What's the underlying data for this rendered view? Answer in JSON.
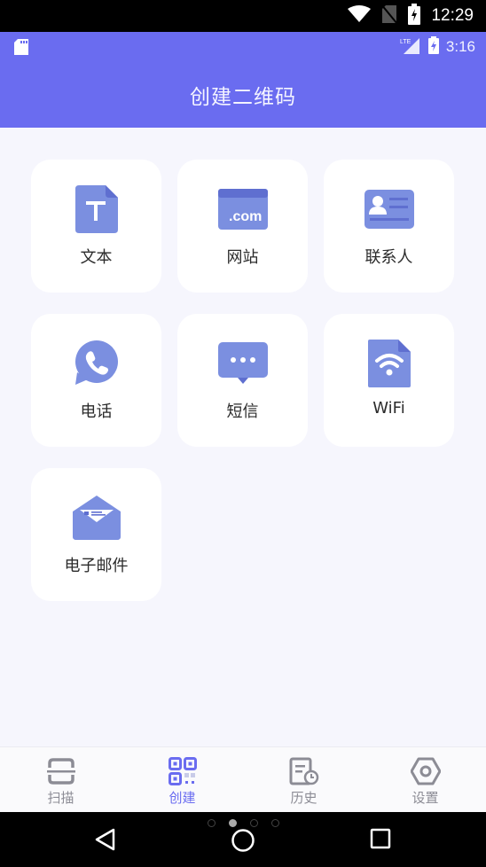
{
  "system_status": {
    "time": "12:29",
    "icons": [
      "wifi-icon",
      "no-sim-icon",
      "battery-charging-icon"
    ]
  },
  "app_status": {
    "time": "3:16",
    "left_icons": [
      "sd-card-icon"
    ],
    "right_icons": [
      "lte-signal-icon",
      "battery-charging-icon"
    ]
  },
  "header": {
    "title": "创建二维码"
  },
  "colors": {
    "accent": "#6a6cf0",
    "icon_fill": "#7b8fe0",
    "background": "#f6f6fd",
    "card": "#ffffff",
    "tab_inactive": "#8c8c95"
  },
  "create_types": [
    {
      "label": "文本",
      "icon": "text-document-icon"
    },
    {
      "label": "网站",
      "icon": "website-com-icon"
    },
    {
      "label": "联系人",
      "icon": "contact-card-icon"
    },
    {
      "label": "电话",
      "icon": "phone-icon"
    },
    {
      "label": "短信",
      "icon": "sms-bubble-icon"
    },
    {
      "label": "WiFi",
      "icon": "wifi-document-icon"
    },
    {
      "label": "电子邮件",
      "icon": "email-envelope-icon"
    }
  ],
  "tabs": [
    {
      "label": "扫描",
      "icon": "scan-icon",
      "active": false
    },
    {
      "label": "创建",
      "icon": "qr-code-icon",
      "active": true
    },
    {
      "label": "历史",
      "icon": "history-icon",
      "active": false
    },
    {
      "label": "设置",
      "icon": "settings-icon",
      "active": false
    }
  ],
  "page_indicator": {
    "count": 4,
    "active_index": 1
  },
  "nav": {
    "back": "back-icon",
    "home": "home-icon",
    "recents": "recents-icon"
  }
}
